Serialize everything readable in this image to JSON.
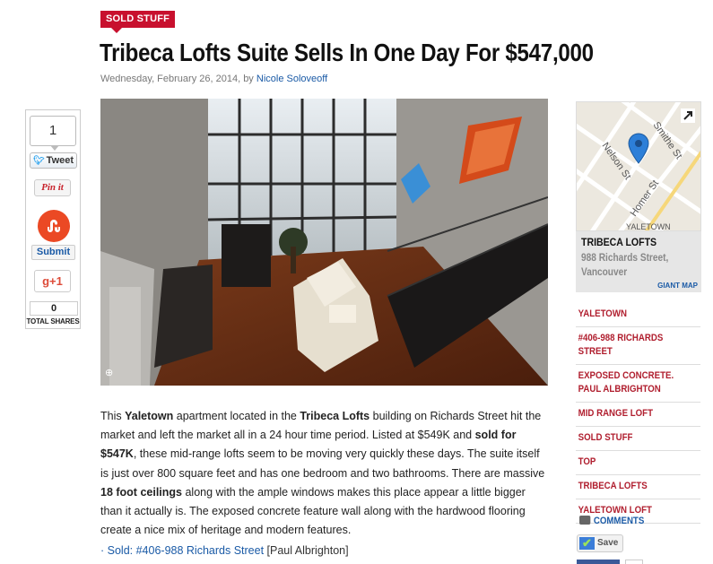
{
  "category": "SOLD STUFF",
  "title": "Tribeca Lofts Suite Sells In One Day For $547,000",
  "byline": {
    "date_prefix": "Wednesday, February 26, 2014, by ",
    "author": "Nicole Soloveoff"
  },
  "share": {
    "count": "1",
    "tweet_label": "Tweet",
    "pin_label": "Pin it",
    "stumble_icon": "stumbleupon-icon",
    "submit_label": "Submit",
    "gplus_label": "g+1",
    "total_shares": "0",
    "total_shares_label": "TOTAL SHARES"
  },
  "article": {
    "p1_a": "This ",
    "yaletown": "Yaletown",
    "p1_b": " apartment located in the ",
    "tribeca": "Tribeca Lofts",
    "p1_c": " building on Richards Street hit the market and left the market all in a 24 hour time period. Listed at $549K and ",
    "sold": "sold for $547K",
    "p1_d": ", these mid-range lofts seem to be moving very quickly these days. The suite itself is just over 800 square feet and has one bedroom and two bathrooms. There are massive ",
    "ceilings": "18 foot ceilings",
    "p1_e": " along with the ample windows makes this place appear a little bigger than it actually is. The exposed concrete feature wall along with the hardwood flooring create a nice mix of heritage and modern features."
  },
  "source": {
    "prefix": "· ",
    "link": "Sold: #406-988 Richards Street",
    "credit": " [Paul Albrighton]"
  },
  "map": {
    "streets": [
      "Nelson St",
      "Smithe St",
      "Homer St",
      "YALETOWN"
    ],
    "title": "TRIBECA LOFTS",
    "address": "988 Richards Street, Vancouver",
    "giant_map": "GIANT MAP"
  },
  "tags": [
    "YALETOWN",
    "#406-988 RICHARDS STREET",
    "EXPOSED CONCRETE. PAUL ALBRIGHTON",
    "MID RANGE LOFT",
    "SOLD STUFF",
    "TOP",
    "TRIBECA LOFTS",
    "YALETOWN LOFT"
  ],
  "comments_label": "COMMENTS",
  "save_label": "Save",
  "colors": {
    "accent": "#c8102e",
    "link": "#1a5aa6",
    "tag": "#b01e2e"
  }
}
